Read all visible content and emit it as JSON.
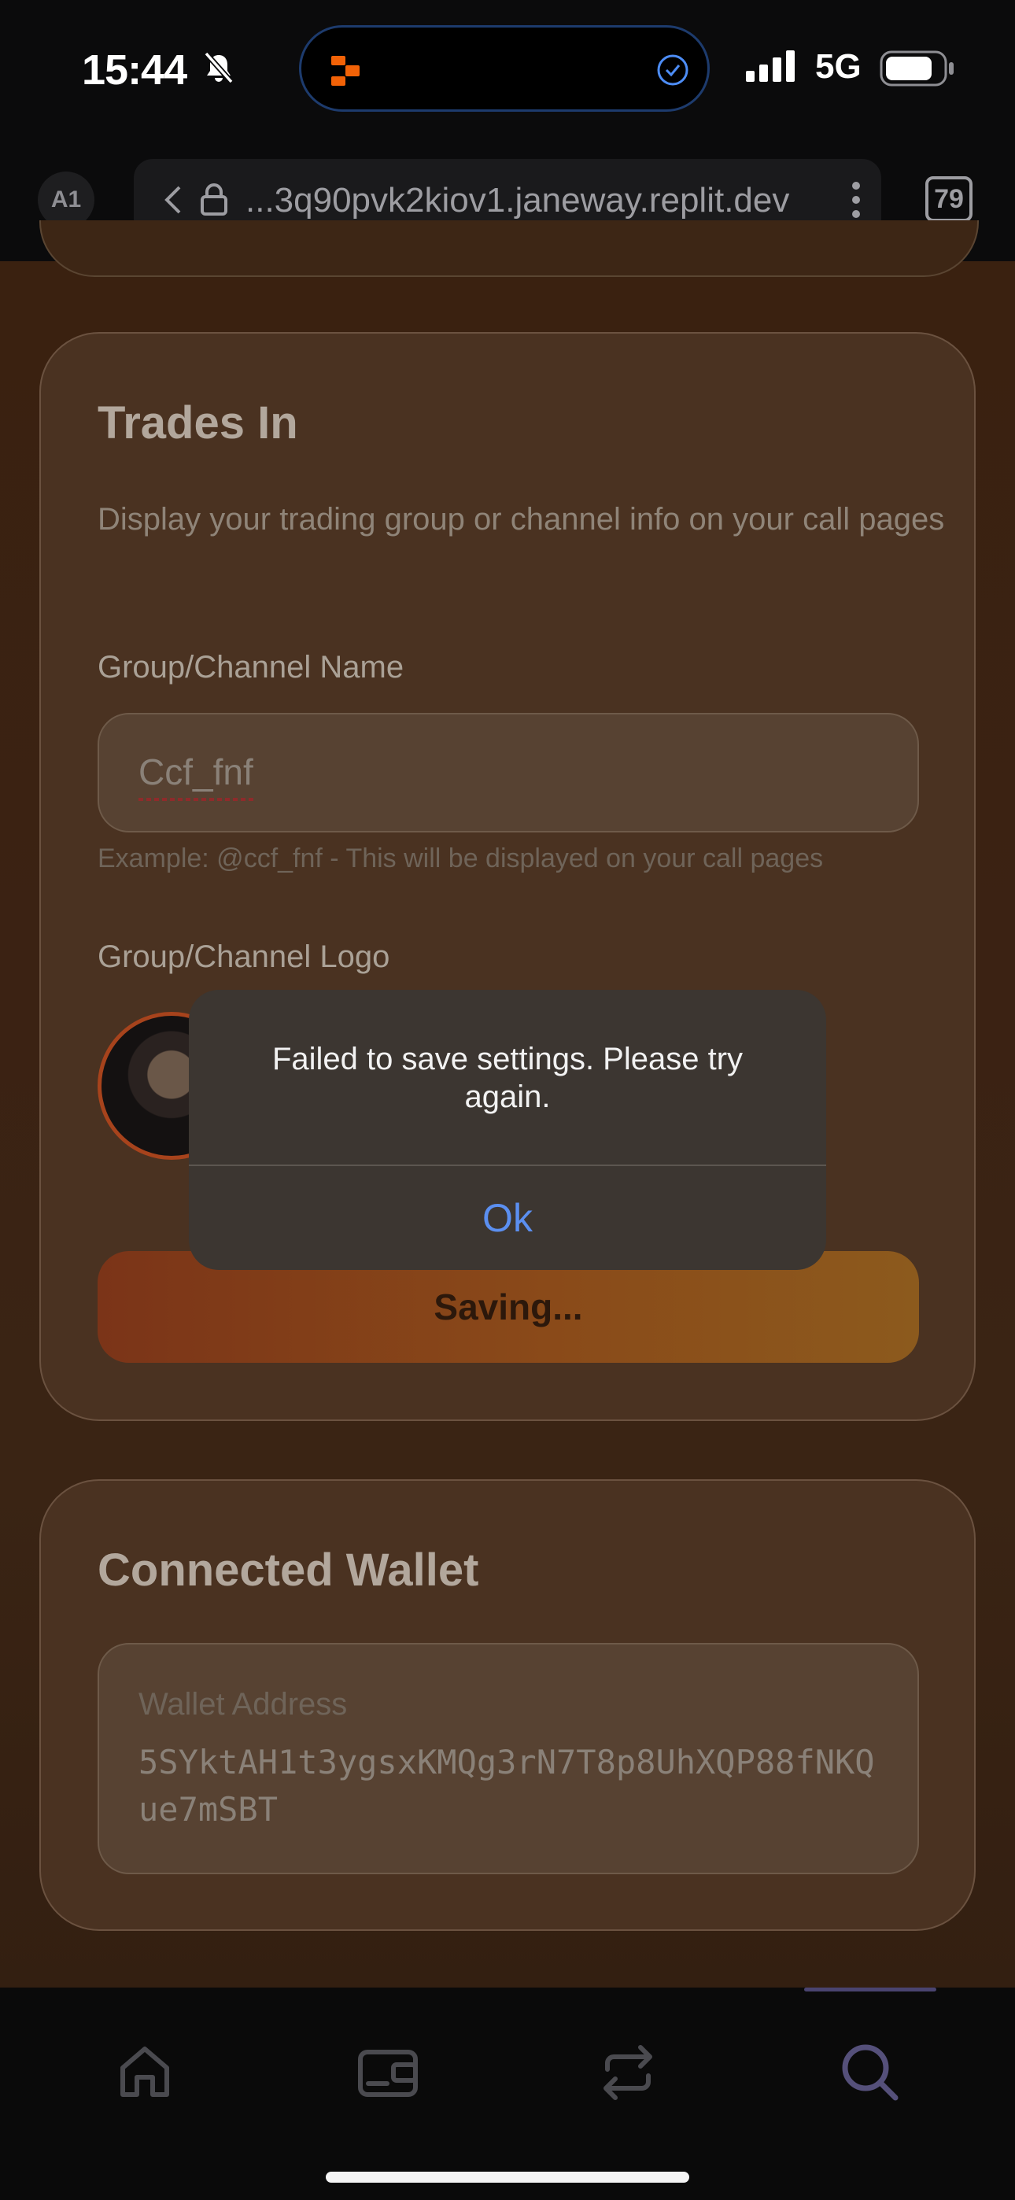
{
  "status_bar": {
    "time": "15:44",
    "network": "5G"
  },
  "browser": {
    "profile": "A1",
    "url": "...3q90pvk2kiov1.janeway.replit.dev",
    "tab_count": "79"
  },
  "trades_card": {
    "title": "Trades In",
    "description": "Display your trading group or channel info on your call pages",
    "name_label": "Group/Channel Name",
    "name_value": "Ccf_fnf",
    "name_hint": "Example: @ccf_fnf - This will be displayed on your call pages",
    "logo_label": "Group/Channel Logo",
    "save_label": "Saving..."
  },
  "wallet_card": {
    "title": "Connected Wallet",
    "address_label": "Wallet Address",
    "address": "5SYktAH1t3ygsxKMQg3rN7T8p8UhXQP88fNKQue7mSBT"
  },
  "alert": {
    "message": "Failed to save settings. Please try again.",
    "ok_label": "Ok"
  },
  "bottom_nav": {
    "items": [
      {
        "icon": "home-icon"
      },
      {
        "icon": "wallet-icon"
      },
      {
        "icon": "swap-icon"
      },
      {
        "icon": "search-icon",
        "active": true
      }
    ]
  },
  "colors": {
    "accent_blue": "#5b8ff0",
    "save_gradient_start": "#7b3418",
    "save_gradient_end": "#8c5a1d"
  }
}
